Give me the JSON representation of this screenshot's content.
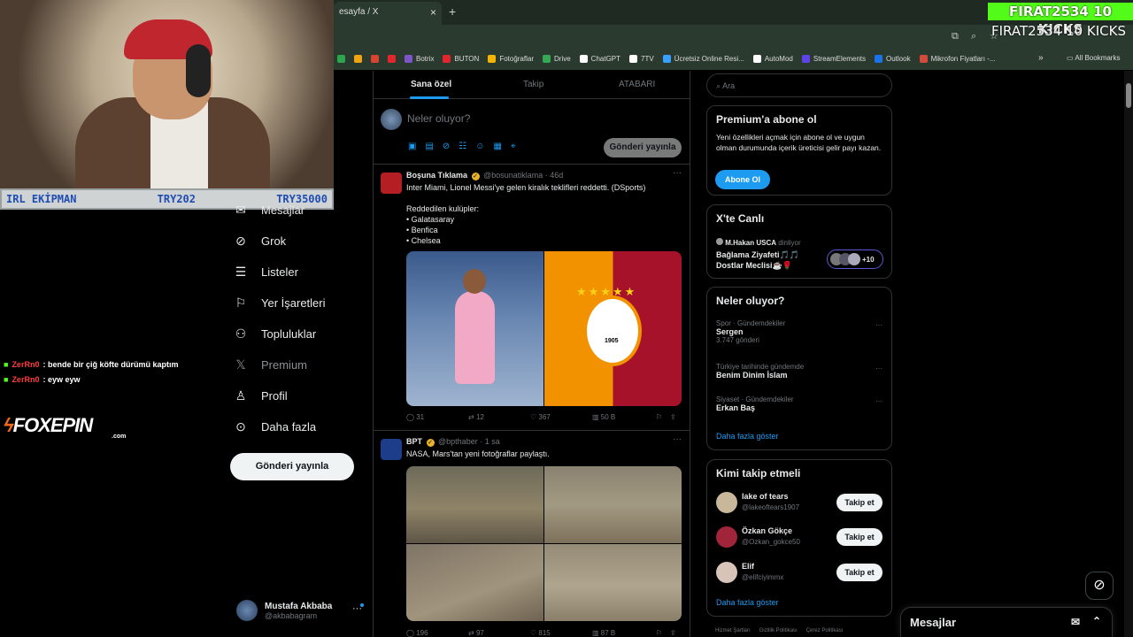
{
  "browser": {
    "tab_title": "esayfa / X",
    "tab_close": "×",
    "new_tab": "+",
    "bookmarks": [
      {
        "label": "",
        "color": "#2ea44f"
      },
      {
        "label": "",
        "color": "#f2a30f"
      },
      {
        "label": "",
        "color": "#d9442f"
      },
      {
        "label": "",
        "color": "#e3262d"
      },
      {
        "label": "Botrix",
        "color": "#7d55c7"
      },
      {
        "label": "BUTON",
        "color": "#e3262d"
      },
      {
        "label": "Fotoğraflar",
        "color": "#f4b400"
      },
      {
        "label": "Drive",
        "color": "#34a853"
      },
      {
        "label": "ChatGPT",
        "color": "#ffffff"
      },
      {
        "label": "7TV",
        "color": "#ffffff"
      },
      {
        "label": "Ücretsiz Online Resi...",
        "color": "#3aa0ff"
      },
      {
        "label": "AutoMod",
        "color": "#ffffff"
      },
      {
        "label": "StreamElements",
        "color": "#5e44e8"
      },
      {
        "label": "Outlook",
        "color": "#1a73e8"
      },
      {
        "label": "Mikrofon Fiyatları -...",
        "color": "#d4493a"
      }
    ],
    "bookmarks_more": "»",
    "all_bookmarks": "All Bookmarks"
  },
  "overlay": {
    "kicks_badge": "FIRAT2534 10 KICKS",
    "kicks_text": "FIRAT2534 10 KICKS",
    "status_left": "IRL EKİPMAN",
    "status_mid": "TRY202",
    "status_right": "TRY35000",
    "chat": [
      {
        "user": "ZerRn0",
        "message": ": bende bir çiğ köfte dürümü kaptım"
      },
      {
        "user": "ZerRn0",
        "message": ": eyw eyw"
      }
    ],
    "sponsor_main": "FOXEPIN",
    "sponsor_sub": ".com"
  },
  "nav": {
    "items": [
      {
        "label": "Mesajlar",
        "icon": "mail-icon"
      },
      {
        "label": "Grok",
        "icon": "grok-icon"
      },
      {
        "label": "Listeler",
        "icon": "list-icon"
      },
      {
        "label": "Yer İşaretleri",
        "icon": "bookmark-icon"
      },
      {
        "label": "Topluluklar",
        "icon": "communities-icon"
      },
      {
        "label": "Premium",
        "icon": "x-logo-icon"
      },
      {
        "label": "Profil",
        "icon": "profile-icon"
      },
      {
        "label": "Daha fazla",
        "icon": "more-icon"
      }
    ],
    "post_button": "Gönderi yayınla",
    "account_name": "Mustafa Akbaba",
    "account_handle": "@akbabagram",
    "account_more": "···"
  },
  "feed": {
    "tabs": [
      "Sana özel",
      "Takip",
      "ATABARI"
    ],
    "compose_placeholder": "Neler oluyor?",
    "compose_button": "Gönderi yayınla",
    "tweets": [
      {
        "name": "Boşuna Tıklama",
        "handle": "@bosunatiklama",
        "time": "· 46d",
        "text": "Inter Miami, Lionel Messi'ye gelen kiralık teklifleri reddetti. (DSports)\n\nReddedilen kulüpler:\n• Galatasaray\n• Benfica\n• Chelsea",
        "replies": "31",
        "reposts": "12",
        "likes": "367",
        "views": "50 B",
        "image_caption": "1905"
      },
      {
        "name": "BPT",
        "handle": "@bpthaber",
        "time": "· 1 sa",
        "text": "NASA, Mars'tan yeni fotoğraflar paylaştı.",
        "replies": "196",
        "reposts": "97",
        "likes": "815",
        "views": "87 B"
      }
    ],
    "more_label": "···"
  },
  "right": {
    "search_placeholder": "Ara",
    "premium": {
      "title": "Premium'a abone ol",
      "text": "Yeni özellikleri açmak için abone ol ve uygun olman durumunda içerik üreticisi gelir payı kazan.",
      "button": "Abone Ol"
    },
    "live": {
      "title": "X'te Canlı",
      "host": "M.Hakan USCA",
      "host_status": "dinliyor",
      "line1": "Bağlama Ziyafeti🎵🎵",
      "line2": "Dostlar Meclisi☕🌹",
      "extra": "+10"
    },
    "trends": {
      "title": "Neler oluyor?",
      "items": [
        {
          "context": "Spor · Gündemdekiler",
          "title": "Sergen",
          "count": "3.747 gönderi"
        },
        {
          "context": "Türkiye tarihinde gündemde",
          "title": "Benim Dinim İslam",
          "count": ""
        },
        {
          "context": "Siyaset · Gündemdekiler",
          "title": "Erkan Baş",
          "count": ""
        }
      ],
      "show_more": "Daha fazla göster"
    },
    "who_to_follow": {
      "title": "Kimi takip etmeli",
      "users": [
        {
          "name": "lake of tears",
          "handle": "@lakeoftears1907",
          "button": "Takip et"
        },
        {
          "name": "Özkan Gökçe",
          "handle": "@Ozkan_gokce50",
          "button": "Takip et"
        },
        {
          "name": "Elif",
          "handle": "@elifciyimmx",
          "button": "Takip et"
        }
      ],
      "show_more": "Daha fazla göster"
    },
    "footer": [
      "Hizmet Şartları",
      "Gizlilik Politikası",
      "Çerez Politikası"
    ]
  },
  "messages_dock": {
    "title": "Mesajlar"
  }
}
